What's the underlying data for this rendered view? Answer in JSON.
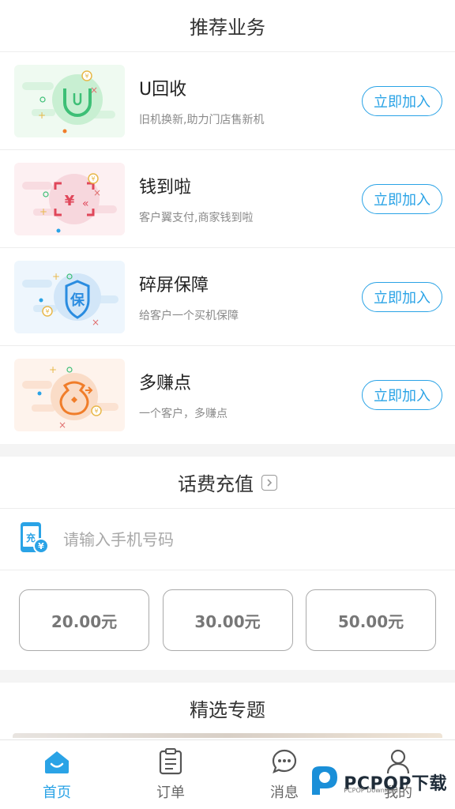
{
  "recommend": {
    "title": "推荐业务",
    "join_label": "立即加入",
    "items": [
      {
        "name": "U回收",
        "desc": "旧机换新,助力门店售新机",
        "icon": "recycle-u-icon"
      },
      {
        "name": "钱到啦",
        "desc": "客户翼支付,商家钱到啦",
        "icon": "scan-yuan-icon"
      },
      {
        "name": "碎屏保障",
        "desc": "给客户一个买机保障",
        "icon": "shield-bao-icon"
      },
      {
        "name": "多赚点",
        "desc": "一个客户，多赚点",
        "icon": "money-bag-icon"
      }
    ]
  },
  "recharge": {
    "title": "话费充值",
    "phone_placeholder": "请输入手机号码",
    "phone_value": "",
    "icon_char": "充",
    "amounts": [
      "20.00元",
      "30.00元",
      "50.00元"
    ]
  },
  "featured": {
    "title": "精选专题"
  },
  "tabbar": {
    "items": [
      {
        "label": "首页",
        "icon": "home-icon",
        "active": true
      },
      {
        "label": "订单",
        "icon": "clipboard-icon",
        "active": false
      },
      {
        "label": "消息",
        "icon": "chat-icon",
        "active": false
      },
      {
        "label": "我的",
        "icon": "user-icon",
        "active": false
      }
    ]
  },
  "watermark": {
    "text": "PCPOP下载",
    "sub": "PCPOP Download"
  },
  "colors": {
    "accent": "#2aa3e6",
    "green": "#3dbf76",
    "red": "#e0475a",
    "blue": "#2a8ce0",
    "orange": "#f07d2a"
  }
}
